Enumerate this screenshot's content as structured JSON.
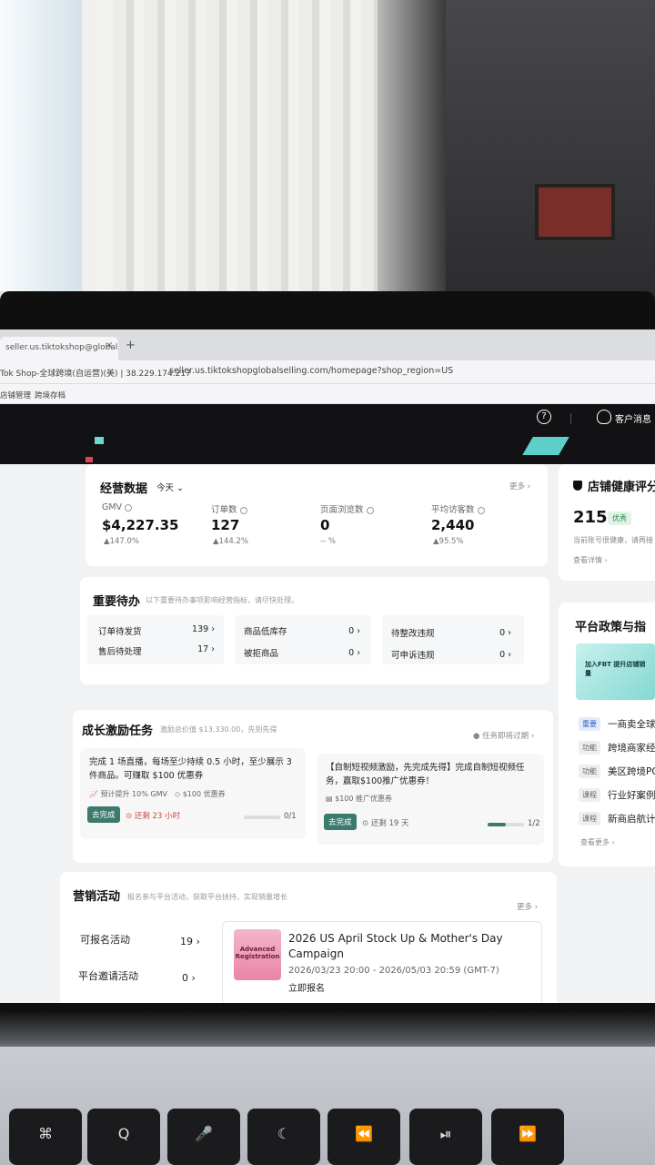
{
  "browser": {
    "tab_title": "seller.us.tiktokshop@globalse",
    "tab_close": "×",
    "new_tab": "+",
    "proxy_label": "Tok Shop-全球跨境(自运营)(美) | 38.229.174.217",
    "url": "seller.us.tiktokshopglobalselling.com/homepage?shop_region=US",
    "bookmarks": [
      "店铺管理",
      "跨境存档"
    ]
  },
  "topnav": {
    "help_icon": "?",
    "customer_message": "客户消息"
  },
  "business_data": {
    "title": "经营数据",
    "period": "今天",
    "more": "更多 ›",
    "metrics": [
      {
        "label": "GMV",
        "value": "$4,227.35",
        "change": "▲147.0%"
      },
      {
        "label": "订单数",
        "value": "127",
        "change": "▲144.2%"
      },
      {
        "label": "页面浏览数",
        "value": "0",
        "change": "-- %"
      },
      {
        "label": "平均访客数",
        "value": "2,440",
        "change": "▲95.5%"
      }
    ]
  },
  "todo": {
    "title": "重要待办",
    "subtitle": "以下重要待办事项影响经营指标，请尽快处理。",
    "items": [
      {
        "label": "订单待发货",
        "count": "139 ›"
      },
      {
        "label": "售后待处理",
        "count": "17 ›"
      },
      {
        "label": "商品低库存",
        "count": "0 ›"
      },
      {
        "label": "被拒商品",
        "count": "0 ›"
      },
      {
        "label": "待整改违规",
        "count": "0 ›"
      },
      {
        "label": "可申诉违规",
        "count": "0 ›"
      }
    ]
  },
  "growth": {
    "title": "成长激励任务",
    "subtitle": "激励总价值 $13,330.00，先到先得",
    "expiring": "● 任务即将过期 ›",
    "tasks": [
      {
        "text": "完成 1 场直播，每场至少持续 0.5 小时，至少展示 3 件商品。可赚取 $100 优惠券",
        "sub1": "📈 预计提升 10% GMV",
        "sub2": "◇ $100 优惠券",
        "button": "去完成",
        "remaining": "⊙ 还剩 23 小时",
        "progress_text": "0/1",
        "progress": 0
      },
      {
        "text": "【自制短视频激励，先完成先得】完成自制短视频任务，赢取$100推广优惠券！",
        "sub1": "▤ $100 推广优惠券",
        "button": "去完成",
        "remaining": "⊙ 还剩 19 天",
        "progress_text": "1/2",
        "progress": 0.5
      }
    ]
  },
  "marketing": {
    "title": "营销活动",
    "subtitle": "报名参与平台活动，获取平台扶持，实现销量增长",
    "more": "更多 ›",
    "rows": [
      {
        "label": "可报名活动",
        "count": "19 ›"
      },
      {
        "label": "平台邀请活动",
        "count": "0 ›"
      }
    ],
    "campaign": {
      "thumb_text": "Advanced Registration",
      "title": "2026 US April Stock Up & Mother's Day Campaign",
      "date": "2026/03/23 20:00 - 2026/05/03 20:59 (GMT-7)",
      "link": "立即报名"
    }
  },
  "right": {
    "health_title": "店铺健康评分",
    "health_score": "215",
    "health_badge": "优秀",
    "health_desc": "当前账号很健康，请再接",
    "health_link": "查看详情 ›",
    "policy_title": "平台政策与指",
    "banner_text": "加入FBT 提升店铺销量",
    "items": [
      {
        "tag": "重要",
        "text": "一商卖全球："
      },
      {
        "tag": "功能",
        "text": "跨境商家经营"
      },
      {
        "tag": "功能",
        "text": "美区跨境PO"
      },
      {
        "tag": "课程",
        "text": "行业好案例"
      },
      {
        "tag": "课程",
        "text": "新商启航计"
      }
    ],
    "more": "查看更多 ›"
  },
  "keys": [
    "⌘",
    "Q",
    "🎤",
    "☾",
    "⏪",
    "⏯",
    "⏩"
  ]
}
